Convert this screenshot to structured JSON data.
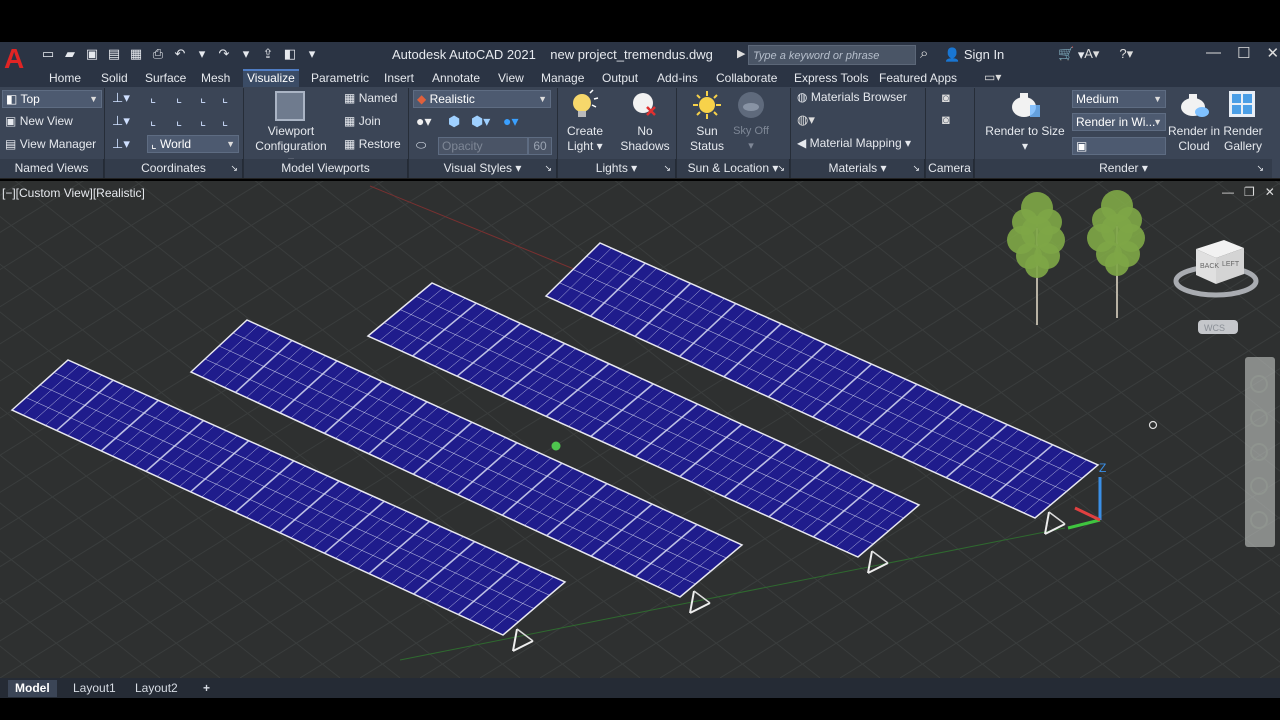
{
  "app": {
    "logo": "A",
    "title": "Autodesk AutoCAD 2021",
    "filename": "new project_tremendus.dwg",
    "search_placeholder": "Type a keyword or phrase",
    "sign_in": "Sign In"
  },
  "tabs": [
    "Home",
    "Solid",
    "Surface",
    "Mesh",
    "Visualize",
    "Parametric",
    "Insert",
    "Annotate",
    "View",
    "Manage",
    "Output",
    "Add-ins",
    "Collaborate",
    "Express Tools",
    "Featured Apps"
  ],
  "active_tab": "Visualize",
  "ribbon": {
    "named_views": {
      "view_combo": "Top",
      "new_view": "New View",
      "view_manager": "View Manager",
      "footer": "Named Views"
    },
    "coordinates": {
      "ucs_combo": "World",
      "footer": "Coordinates"
    },
    "model_viewports": {
      "viewport_config_line1": "Viewport",
      "viewport_config_line2": "Configuration",
      "named": "Named",
      "join": "Join",
      "restore": "Restore",
      "footer": "Model Viewports"
    },
    "visual_styles": {
      "style_combo": "Realistic",
      "opacity": "Opacity",
      "opacity_value": "60",
      "footer": "Visual Styles"
    },
    "lights": {
      "create_light_1": "Create",
      "create_light_2": "Light",
      "no_shadows_1": "No",
      "no_shadows_2": "Shadows",
      "footer": "Lights"
    },
    "sun_location": {
      "sun_status_1": "Sun",
      "sun_status_2": "Status",
      "sky_off": "Sky Off",
      "footer": "Sun & Location"
    },
    "materials": {
      "browser": "Materials Browser",
      "mapping": "Material Mapping",
      "footer": "Materials"
    },
    "camera": {
      "footer": "Camera"
    },
    "render": {
      "render_to_size": "Render to Size",
      "quality_combo": "Medium",
      "render_in_combo": "Render in Wi...",
      "cloud_1": "Render in",
      "cloud_2": "Cloud",
      "gallery_1": "Render",
      "gallery_2": "Gallery",
      "footer": "Render"
    }
  },
  "viewport": {
    "label": "[−][Custom View][Realistic]",
    "viewcube_back": "BACK",
    "viewcube_left": "LEFT",
    "wcs": "WCS",
    "axis_z": "Z"
  },
  "layout_tabs": [
    "Model",
    "Layout1",
    "Layout2"
  ],
  "active_layout": "Model",
  "add_layout": "+",
  "colors": {
    "panel_blue": "#1f1c8c",
    "panel_grid": "#d8dcf4",
    "ground": "#2e3030",
    "ribbon": "#3b4556",
    "accent": "#4f7cc3"
  }
}
